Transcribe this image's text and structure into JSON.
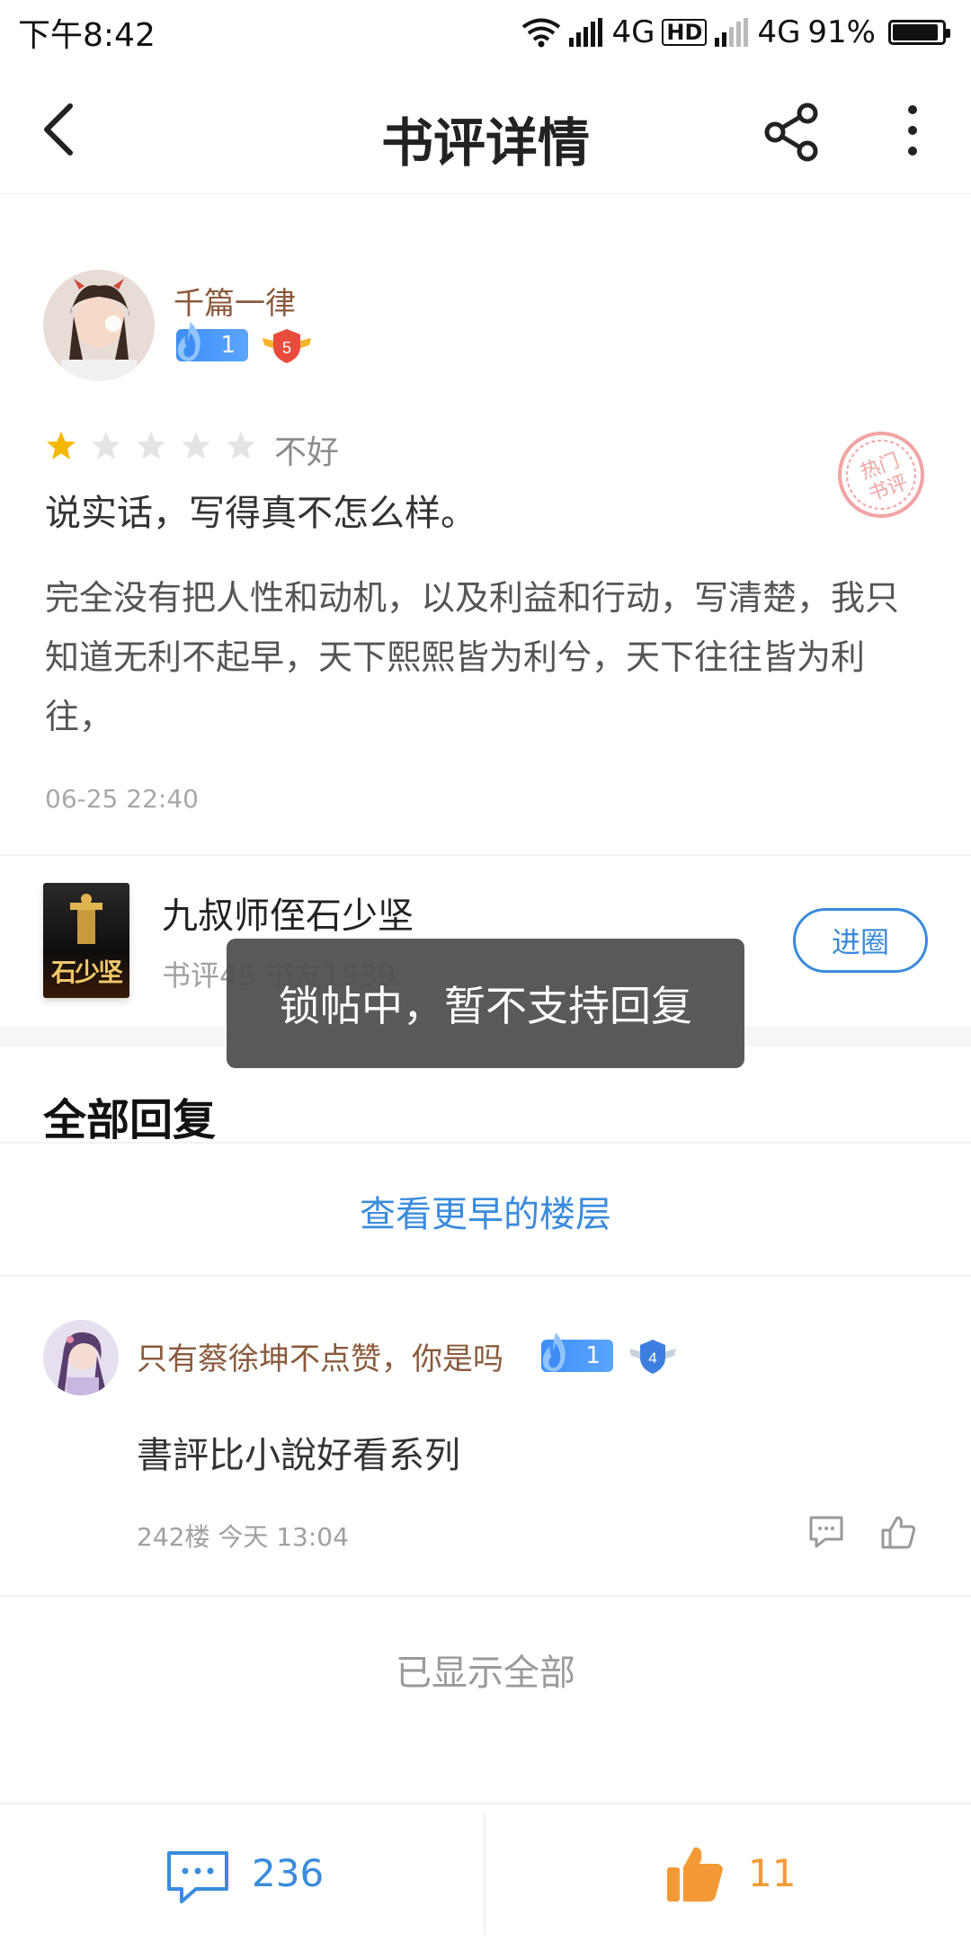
{
  "status_bar": {
    "time": "下午8:42",
    "network1": "4G",
    "hd": "HD",
    "network2": "4G",
    "battery": "91%"
  },
  "nav": {
    "title": "书评详情"
  },
  "review": {
    "author": "千篇一律",
    "author_level": "1",
    "author_badge": "5",
    "rating_stars": 1,
    "rating_max": 5,
    "rating_text": "不好",
    "title": "说实话，写得真不怎么样。",
    "body": "完全没有把人性和动机，以及利益和行动，写清楚，我只知道无利不起早，天下熙熙皆为利兮，天下往往皆为利往，",
    "time": "06-25 22:40",
    "stamp_text": "热门书评"
  },
  "book": {
    "title": "九叔师侄石少坚",
    "stats": "书评45  书友1539",
    "cover_text": "石少坚",
    "join_label": "进圈"
  },
  "toast": "锁帖中，暂不支持回复",
  "replies_section": {
    "title": "全部回复",
    "earlier_label": "查看更早的楼层",
    "items": [
      {
        "author": "只有蔡徐坤不点赞，你是吗",
        "level": "1",
        "badge": "4",
        "text": "書評比小說好看系列",
        "meta": "242楼  今天 13:04"
      }
    ],
    "all_shown": "已显示全部"
  },
  "bottom_bar": {
    "comment_count": "236",
    "like_count": "11"
  },
  "colors": {
    "accent_blue": "#3a8bdc",
    "username_brown": "#8a5a3c",
    "like_orange": "#f39a36",
    "star_gold": "#f5b800"
  }
}
